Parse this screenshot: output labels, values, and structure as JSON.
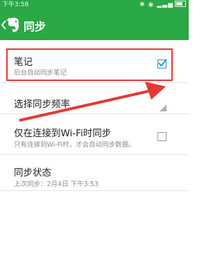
{
  "status_bar": {
    "time": "下午3:58",
    "icons": "✱ ◉ ▂▃▅"
  },
  "app_bar": {
    "title": "同步"
  },
  "settings": [
    {
      "title": "笔记",
      "subtitle": "后台自动同步笔记",
      "checked": true
    },
    {
      "title": "选择同步频率",
      "subtitle": ""
    },
    {
      "title": "仅在连接到Wi-Fi时同步",
      "subtitle": "只有连接到Wi-Fi时，才会自动同步数据。",
      "checked": false
    },
    {
      "title": "同步状态",
      "subtitle": "上次同步：2月4日 下午3:53"
    }
  ],
  "colors": {
    "accent": "#2aa845",
    "highlight": "#e53935",
    "checkbox": "#2b8fd8"
  }
}
